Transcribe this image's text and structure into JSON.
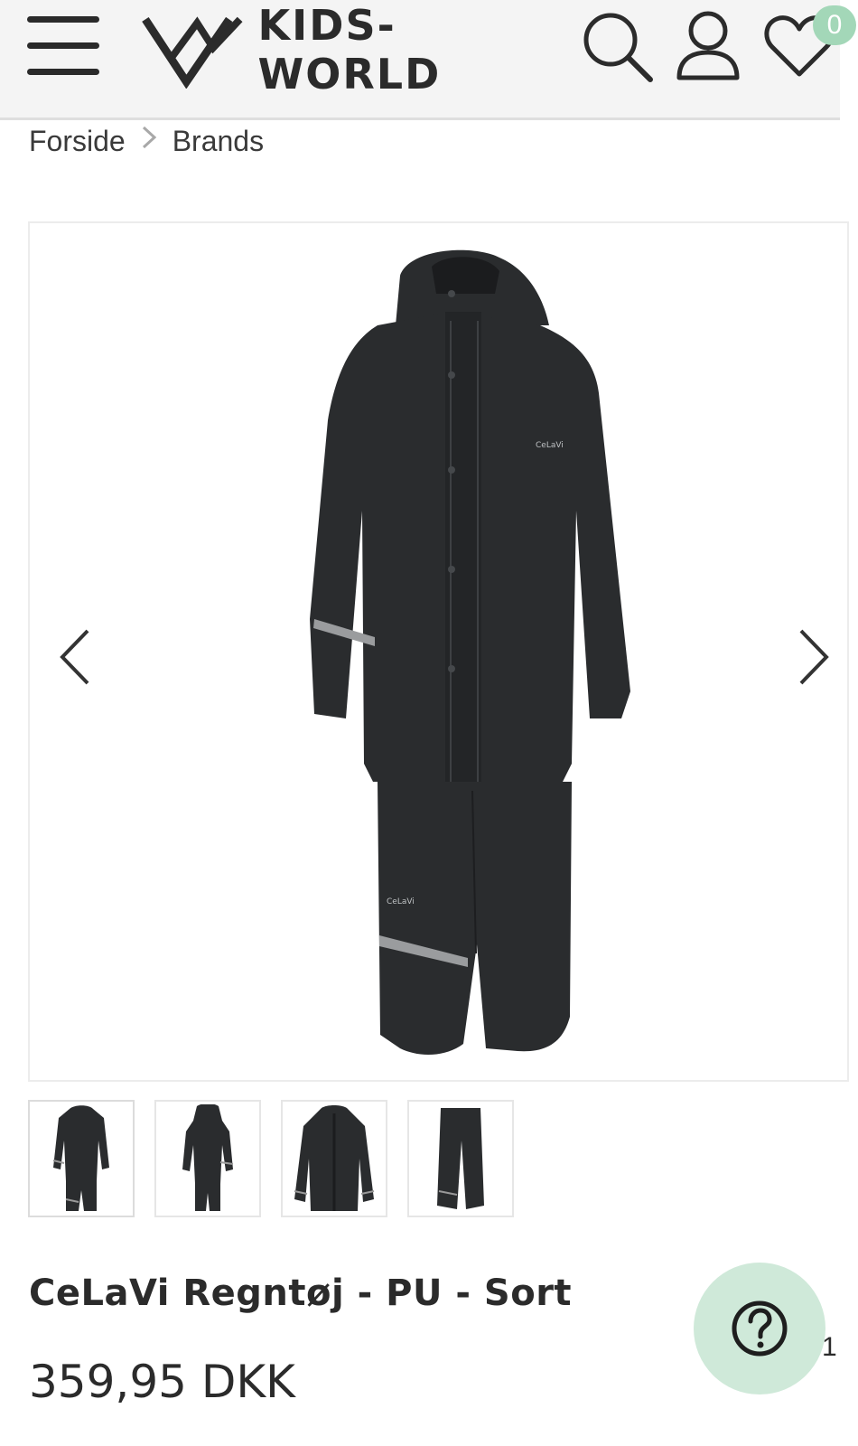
{
  "header": {
    "logo_text": "KIDS-WORLD",
    "menu_icon": "hamburger-menu-icon",
    "search_icon": "search-icon",
    "account_icon": "user-icon",
    "wishlist_icon": "heart-icon",
    "wishlist_count": "0"
  },
  "breadcrumb": {
    "items": [
      "Forside",
      "Brands"
    ],
    "separator": ">"
  },
  "gallery": {
    "prev_icon": "chevron-left-icon",
    "next_icon": "chevron-right-icon",
    "thumbnails": [
      "set-front",
      "set-back",
      "jacket",
      "pants"
    ]
  },
  "product": {
    "title": "CeLaVi Regntøj - PU - Sort",
    "price": "359,95 DKK",
    "brand_mark": "CeLaVi"
  },
  "help": {
    "icon": "question-icon",
    "side_number": "1"
  },
  "colors": {
    "header_bg": "#f4f4f4",
    "badge": "#a3d7b8",
    "help_bg": "#cfe9d9",
    "garment": "#2a2c2e"
  }
}
